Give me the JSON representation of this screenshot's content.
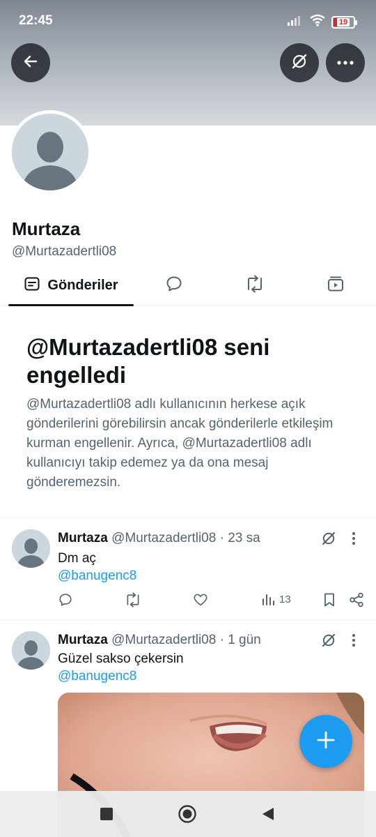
{
  "status_bar": {
    "time": "22:45",
    "battery": "19"
  },
  "profile": {
    "name": "Murtaza",
    "handle": "@Murtazadertli08"
  },
  "tabs": [
    {
      "label": "Gönderiler",
      "icon": "posts-icon",
      "selected": true
    },
    {
      "label": "",
      "icon": "replies-icon",
      "selected": false
    },
    {
      "label": "",
      "icon": "reposts-icon",
      "selected": false
    },
    {
      "label": "",
      "icon": "media-icon",
      "selected": false
    }
  ],
  "blocked": {
    "title": "@Murtazadertli08 seni engelledi",
    "description": "@Murtazadertli08 adlı kullanıcının herkese açık gönderilerini görebilirsin ancak gönderilerle etkileşim kurman engellenir. Ayrıca, @Murtazadertli08 adlı kullanıcıyı takip edemez ya da ona mesaj gönderemezsin."
  },
  "posts": [
    {
      "name": "Murtaza",
      "meta": "@Murtazadertli08 · 23 sa",
      "text": "Dm aç",
      "mention": "@banugenc8",
      "views": "13"
    },
    {
      "name": "Murtaza",
      "meta": "@Murtazadertli08 · 1 gün",
      "text": "Güzel sakso çekersin",
      "mention": "@banugenc8"
    }
  ],
  "colors": {
    "accent": "#1d9bf0",
    "text": "#0f1419",
    "muted": "#536471"
  }
}
